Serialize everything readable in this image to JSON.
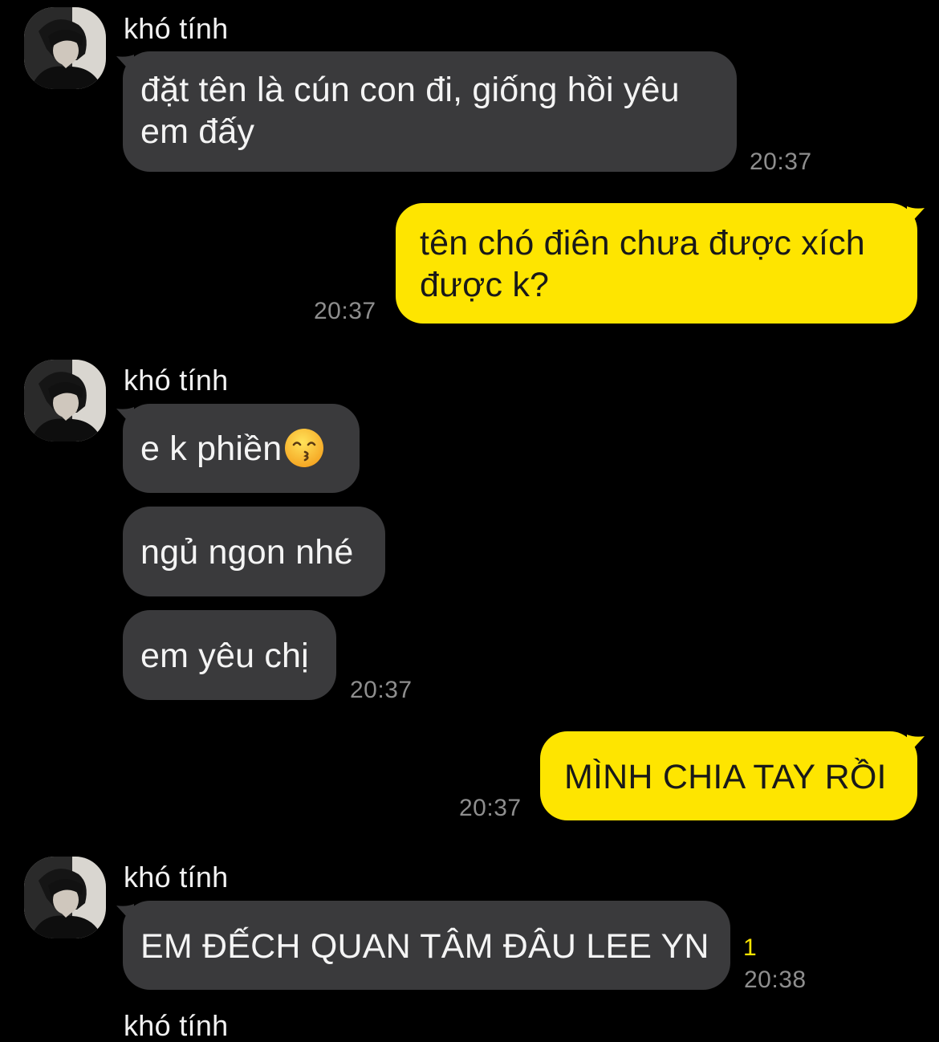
{
  "chat": {
    "contact_name": "khó tính",
    "colors": {
      "background": "#000000",
      "incoming_bubble": "#3a3a3c",
      "outgoing_bubble": "#fee500",
      "time": "#8e8e8e",
      "unread": "#fee500"
    },
    "messages": [
      {
        "id": "m1",
        "direction": "incoming",
        "sender": "khó tính",
        "line1": "đặt tên là cún con đi, giống hồi yêu",
        "line2": "em đấy",
        "time": "20:37"
      },
      {
        "id": "m2",
        "direction": "outgoing",
        "line1": "tên chó điên chưa được xích",
        "line2": "được k?",
        "time": "20:37"
      },
      {
        "id": "m3",
        "direction": "incoming",
        "sender": "khó tính",
        "text": "e k phiền",
        "emoji": "kissing-face-with-smiling-eyes"
      },
      {
        "id": "m4",
        "direction": "incoming",
        "text": "ngủ ngon nhé"
      },
      {
        "id": "m5",
        "direction": "incoming",
        "text": "em yêu chị",
        "time": "20:37"
      },
      {
        "id": "m6",
        "direction": "outgoing",
        "text": "MÌNH CHIA TAY RỒI",
        "time": "20:37"
      },
      {
        "id": "m7",
        "direction": "incoming",
        "sender": "khó tính",
        "text": "EM ĐẾCH QUAN TÂM ĐÂU LEE YN",
        "unread_count": "1",
        "time": "20:38"
      }
    ],
    "partial_sender": "khó tính"
  }
}
